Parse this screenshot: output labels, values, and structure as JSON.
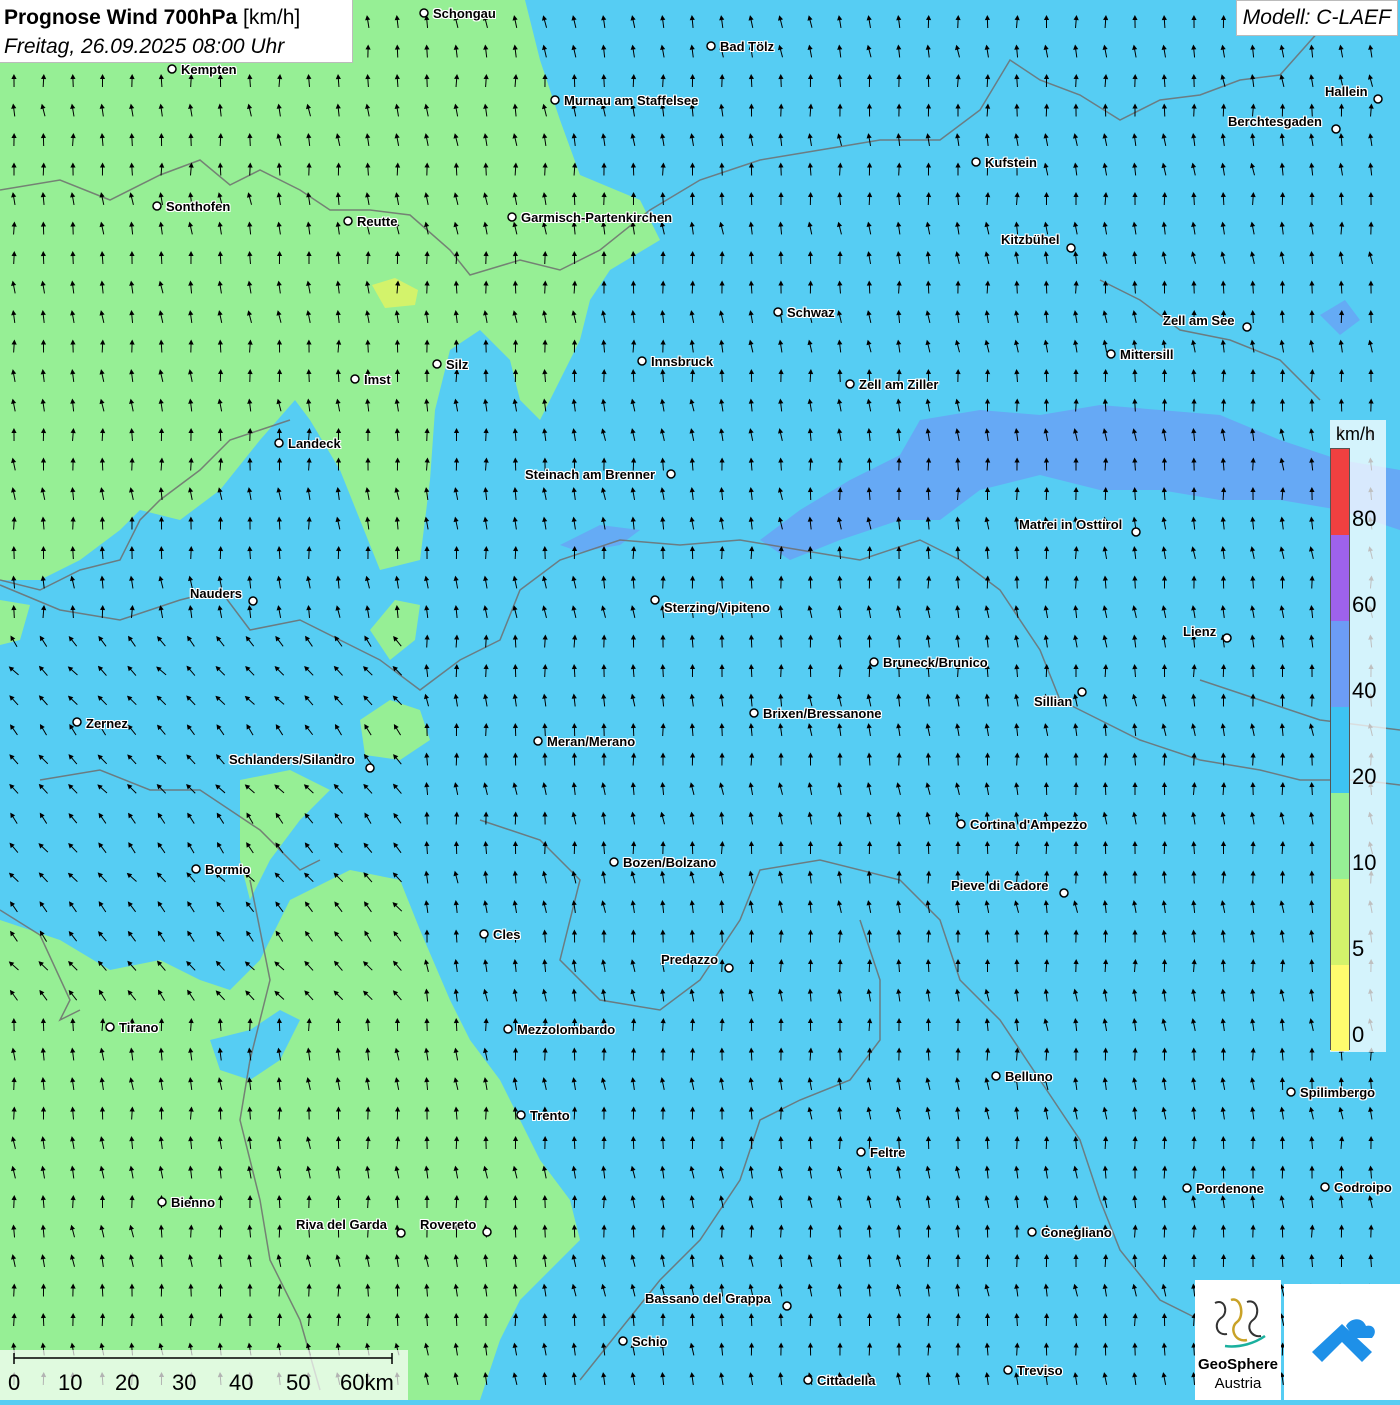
{
  "header": {
    "title_bold": "Prognose Wind 700hPa",
    "title_unit": "[km/h]",
    "subtitle": "Freitag, 26.09.2025 08:00 Uhr",
    "model": "Modell: C-LAEF"
  },
  "colors": {
    "speed_0_5": "#fffb6e",
    "speed_5_10": "#d3f36b",
    "speed_10_20": "#96ef95",
    "speed_20_40": "#56cdf3",
    "speed_40_60": "#6c9cf5",
    "speed_60_80": "#9e62eb",
    "speed_80_plus": "#f04040",
    "borders": "#6e6e6e",
    "arrows": "#000000"
  },
  "wind": {
    "dominant_direction": "south (arrows point north)",
    "arrow_icon": "wind-arrow-icon"
  },
  "cities": [
    {
      "name": "Schongau"
    },
    {
      "name": "Bad Tölz"
    },
    {
      "name": "Kempten"
    },
    {
      "name": "Murnau am Staffelsee"
    },
    {
      "name": "Hallein"
    },
    {
      "name": "Berchtesgaden"
    },
    {
      "name": "Kufstein"
    },
    {
      "name": "Sonthofen"
    },
    {
      "name": "Reutte"
    },
    {
      "name": "Garmisch-Partenkirchen"
    },
    {
      "name": "Kitzbühel"
    },
    {
      "name": "Schwaz"
    },
    {
      "name": "Zell am See"
    },
    {
      "name": "Innsbruck"
    },
    {
      "name": "Mittersill"
    },
    {
      "name": "Silz"
    },
    {
      "name": "Imst"
    },
    {
      "name": "Zell am Ziller"
    },
    {
      "name": "Landeck"
    },
    {
      "name": "Steinach am Brenner"
    },
    {
      "name": "Matrei in Osttirol"
    },
    {
      "name": "Nauders"
    },
    {
      "name": "Sterzing/Vipiteno"
    },
    {
      "name": "Lienz"
    },
    {
      "name": "Bruneck/Brunico"
    },
    {
      "name": "Sillian"
    },
    {
      "name": "Zernez"
    },
    {
      "name": "Brixen/Bressanone"
    },
    {
      "name": "Meran/Merano"
    },
    {
      "name": "Schlanders/Silandro"
    },
    {
      "name": "Cortina d'Ampezzo"
    },
    {
      "name": "Bozen/Bolzano"
    },
    {
      "name": "Bormio"
    },
    {
      "name": "Pieve di Cadore"
    },
    {
      "name": "Cles"
    },
    {
      "name": "Predazzo"
    },
    {
      "name": "Tirano"
    },
    {
      "name": "Mezzolombardo"
    },
    {
      "name": "Belluno"
    },
    {
      "name": "Spilimbergo"
    },
    {
      "name": "Trento"
    },
    {
      "name": "Feltre"
    },
    {
      "name": "Pordenone"
    },
    {
      "name": "Codroipo"
    },
    {
      "name": "Bienno"
    },
    {
      "name": "Riva del Garda"
    },
    {
      "name": "Rovereto"
    },
    {
      "name": "Conegliano"
    },
    {
      "name": "Bassano del Grappa"
    },
    {
      "name": "Schio"
    },
    {
      "name": "Treviso"
    },
    {
      "name": "Cittadella"
    }
  ],
  "legend": {
    "unit": "km/h",
    "ticks": [
      "80",
      "60",
      "40",
      "20",
      "10",
      "5",
      "0"
    ]
  },
  "scale": {
    "labels": [
      "0",
      "10",
      "20",
      "30",
      "40",
      "50",
      "60km"
    ]
  },
  "logos": {
    "geosphere_line1": "GeoSphere",
    "geosphere_line2": "Austria",
    "geosphere_icon": "geosphere-logo-icon",
    "app_icon": "app-logo-icon"
  }
}
